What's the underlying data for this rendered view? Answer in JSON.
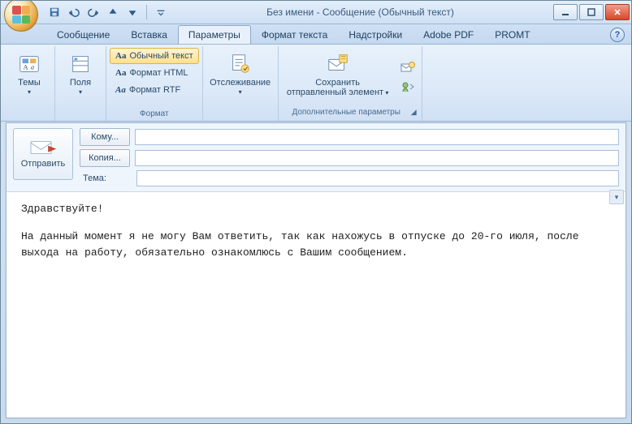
{
  "window": {
    "title": "Без имени - Сообщение (Обычный текст)"
  },
  "qat": {
    "save": "save-icon",
    "undo": "undo-icon",
    "redo": "redo-icon",
    "prev": "prev-icon",
    "next": "next-icon"
  },
  "tabs": [
    {
      "label": "Сообщение",
      "active": false
    },
    {
      "label": "Вставка",
      "active": false
    },
    {
      "label": "Параметры",
      "active": true
    },
    {
      "label": "Формат текста",
      "active": false
    },
    {
      "label": "Надстройки",
      "active": false
    },
    {
      "label": "Adobe PDF",
      "active": false
    },
    {
      "label": "PROMT",
      "active": false
    }
  ],
  "ribbon": {
    "themes": {
      "label": "Темы",
      "group": ""
    },
    "fields": {
      "label": "Поля",
      "group": ""
    },
    "format": {
      "plain": "Обычный текст",
      "html": "Формат HTML",
      "rtf": "Формат RTF",
      "group": "Формат"
    },
    "tracking": {
      "label": "Отслеживание",
      "group": ""
    },
    "save_sent": {
      "line1": "Сохранить",
      "line2": "отправленный элемент"
    },
    "more_group": "Дополнительные параметры"
  },
  "compose": {
    "send": "Отправить",
    "to_btn": "Кому...",
    "cc_btn": "Копия...",
    "subject_label": "Тема:",
    "to_value": "",
    "cc_value": "",
    "subject_value": ""
  },
  "body": {
    "greeting": "Здравствуйте!",
    "paragraph": "На данный момент я не могу Вам ответить, так как нахожусь в отпуске до 20-го июля, после выхода на работу, обязательно ознакомлюсь с Вашим сообщением."
  },
  "help": "?"
}
